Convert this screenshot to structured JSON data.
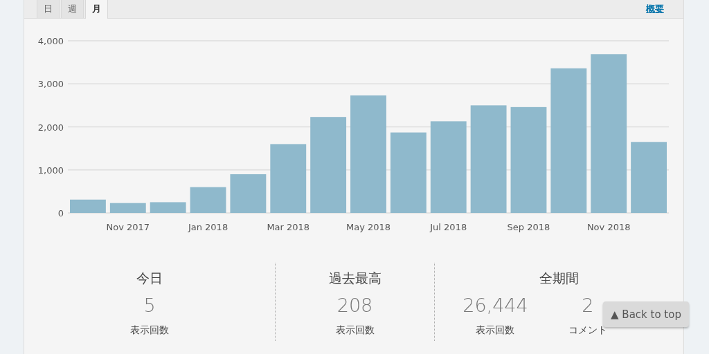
{
  "tabs": [
    {
      "label": "日",
      "selected": false
    },
    {
      "label": "週",
      "selected": false
    },
    {
      "label": "月",
      "selected": true
    }
  ],
  "summary_link": "概要",
  "chart_data": {
    "type": "bar",
    "categories": [
      null,
      "Nov 2017",
      null,
      "Jan 2018",
      null,
      "Mar 2018",
      null,
      "May 2018",
      null,
      "Jul 2018",
      null,
      "Sep 2018",
      null,
      "Nov 2018",
      null
    ],
    "values": [
      310,
      230,
      250,
      600,
      900,
      1600,
      2230,
      2730,
      1870,
      2130,
      2500,
      2460,
      3360,
      3690,
      1650
    ],
    "ylim": [
      0,
      4000
    ],
    "grid": true,
    "yticks": [
      {
        "value": 0,
        "label": "0"
      },
      {
        "value": 1000,
        "label": "1,000"
      },
      {
        "value": 2000,
        "label": "2,000"
      },
      {
        "value": 3000,
        "label": "3,000"
      },
      {
        "value": 4000,
        "label": "4,000"
      }
    ]
  },
  "stats": [
    {
      "title": "今日",
      "items": [
        {
          "value": "5",
          "label": "表示回数"
        }
      ]
    },
    {
      "title": "過去最高",
      "items": [
        {
          "value": "208",
          "label": "表示回数"
        }
      ]
    },
    {
      "title": "全期間",
      "items": [
        {
          "value": "26,444",
          "label": "表示回数"
        },
        {
          "value": "2",
          "label": "コメント"
        }
      ]
    }
  ],
  "back_to_top": "▲ Back to top"
}
